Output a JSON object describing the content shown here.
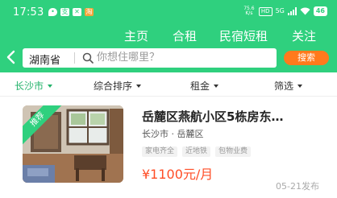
{
  "status_bar": {
    "time": "17:53",
    "app_icons": [
      "message-icon",
      "alipay-icon",
      "close-box-icon",
      "taobao-icon"
    ],
    "app_glyphs": [
      "•",
      "支",
      "✕",
      "淘"
    ],
    "speed": "75.6 K/s",
    "hd_label": "HD",
    "network_label": "5G",
    "battery": "46"
  },
  "top_nav": {
    "items": [
      "主页",
      "合租",
      "民宿短租",
      "关注"
    ]
  },
  "search": {
    "city": "湖南省",
    "placeholder": "你想住哪里？",
    "button_label": "搜索"
  },
  "filters": [
    {
      "label": "长沙市",
      "active": true
    },
    {
      "label": "综合排序",
      "active": false
    },
    {
      "label": "租金",
      "active": false
    },
    {
      "label": "筛选",
      "active": false
    }
  ],
  "listing": {
    "badge": "推荐",
    "title": "岳麓区燕航小区5栋房东…",
    "location": "长沙市 · 岳麓区",
    "tags": [
      "家电齐全",
      "近地铁",
      "包物业费"
    ],
    "price": "¥1100元/月",
    "date": "05-21发布"
  },
  "colors": {
    "brand_green": "#2fd07e",
    "active_filter": "#22b26a",
    "search_button": "#ff7a1c",
    "price": "#ff4d26"
  }
}
